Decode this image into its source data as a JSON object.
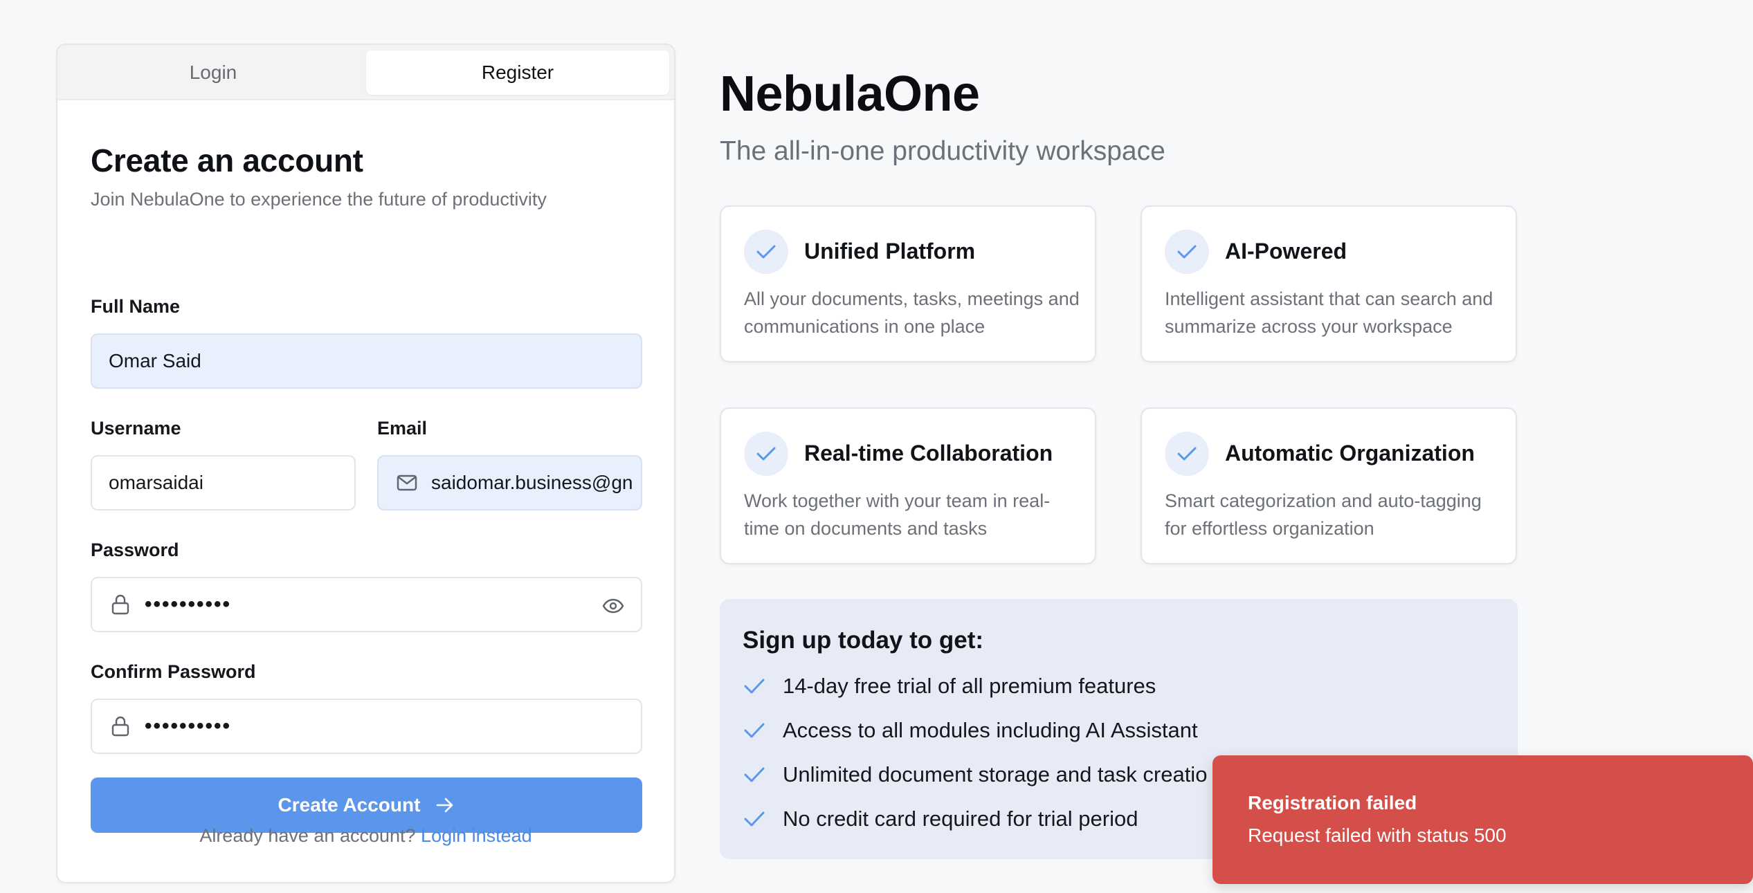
{
  "auth": {
    "tabs": {
      "login": "Login",
      "register": "Register"
    },
    "title": "Create an account",
    "subtitle": "Join NebulaOne to experience the future of productivity",
    "full_name": {
      "label": "Full Name",
      "value": "Omar Said"
    },
    "username": {
      "label": "Username",
      "value": "omarsaidai"
    },
    "email": {
      "label": "Email",
      "value": "saidomar.business@gn"
    },
    "password": {
      "label": "Password",
      "masked": "••••••••••"
    },
    "confirm_password": {
      "label": "Confirm Password",
      "masked": "••••••••••"
    },
    "submit": "Create Account",
    "footer": {
      "text": "Already have an account?",
      "link": "Login instead"
    }
  },
  "brand": {
    "name": "NebulaOne",
    "tagline": "The all-in-one productivity workspace"
  },
  "features": [
    {
      "title": "Unified Platform",
      "desc": "All your documents, tasks, meetings and communications in one place"
    },
    {
      "title": "AI-Powered",
      "desc": "Intelligent assistant that can search and summarize across your workspace"
    },
    {
      "title": "Real-time Collaboration",
      "desc": "Work together with your team in real-time on documents and tasks"
    },
    {
      "title": "Automatic Organization",
      "desc": "Smart categorization and auto-tagging for effortless organization"
    }
  ],
  "signup": {
    "title": "Sign up today to get:",
    "benefits": [
      "14-day free trial of all premium features",
      "Access to all modules including AI Assistant",
      "Unlimited document storage and task creatio",
      "No credit card required for trial period"
    ]
  },
  "toast": {
    "title": "Registration failed",
    "message": "Request failed with status 500"
  },
  "colors": {
    "accent": "#5b95ec",
    "error": "#d44f4a",
    "input_autofill": "#e8f0fe",
    "signup_bg": "#e6ebf5"
  },
  "icons": {
    "email": "mail-icon",
    "password": "lock-icon",
    "toggle": "eye-icon",
    "submit": "arrow-right-icon",
    "feature": "check-icon"
  }
}
